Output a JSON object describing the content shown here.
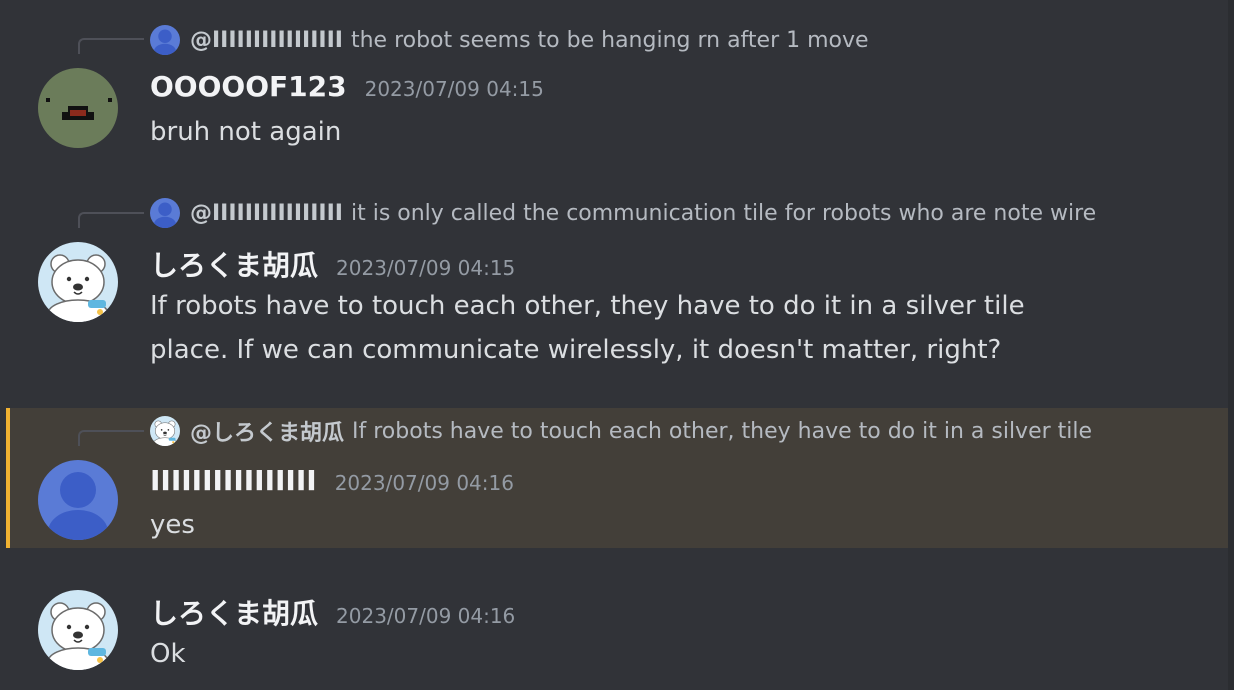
{
  "messages": [
    {
      "reply": {
        "name": "@IIIIIIIIIIIIIIII",
        "text": "the robot seems to be hanging rn after 1 move",
        "avatar_icon": "default-user-avatar-blue"
      },
      "author": "OOOOOF123",
      "timestamp": "2023/07/09 04:15",
      "avatar_icon": "pixel-face-avatar-green",
      "lines": [
        "bruh not again"
      ]
    },
    {
      "reply": {
        "name": "@IIIIIIIIIIIIIIII",
        "text": "it is only called the communication tile for robots who are note wire",
        "avatar_icon": "default-user-avatar-blue"
      },
      "author": "しろくま胡瓜",
      "timestamp": "2023/07/09 04:15",
      "avatar_icon": "polar-bear-avatar",
      "lines": [
        "If robots have to touch each other, they have to do it in a silver tile",
        "place. If we can communicate wirelessly, it doesn't matter, right?"
      ]
    },
    {
      "reply": {
        "name": "@しろくま胡瓜",
        "text": "If robots have to touch each other, they have to do it in a silver tile",
        "avatar_icon": "polar-bear-avatar"
      },
      "author": "IIIIIIIIIIIIIIII",
      "timestamp": "2023/07/09 04:16",
      "avatar_icon": "default-user-avatar-blue",
      "highlighted": true,
      "lines": [
        "yes"
      ]
    },
    {
      "author": "しろくま胡瓜",
      "timestamp": "2023/07/09 04:16",
      "avatar_icon": "polar-bear-avatar",
      "lines": [
        "Ok"
      ]
    }
  ],
  "colors": {
    "background": "#313338",
    "highlight_background": "#433f39",
    "highlight_bar": "#f0b232",
    "author": "#f2f3f5",
    "timestamp": "#949ba4",
    "text": "#dbdee1",
    "blurple_avatar": "#5865f2"
  }
}
